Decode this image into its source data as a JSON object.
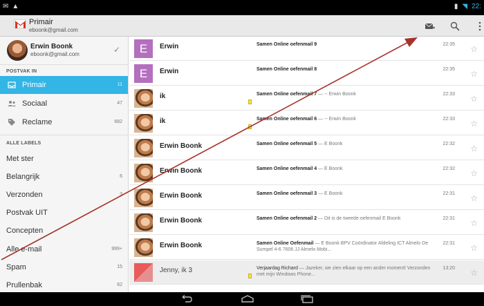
{
  "status_bar": {
    "left_icons": [
      "gmail-notification-icon",
      "person-icon"
    ],
    "time": "22:"
  },
  "action_bar": {
    "title": "Primair",
    "email": "eboonk@gmail.com",
    "icons": [
      "compose-icon",
      "search-icon",
      "overflow-menu-icon"
    ]
  },
  "sidebar": {
    "account": {
      "name": "Erwin Boonk",
      "email": "eboonk@gmail.com"
    },
    "inbox_header": "POSTVAK IN",
    "inbox_items": [
      {
        "label": "Primair",
        "count": "11",
        "icon": "inbox-icon",
        "active": true
      },
      {
        "label": "Sociaal",
        "count": "47",
        "icon": "people-icon"
      },
      {
        "label": "Reclame",
        "count": "682",
        "icon": "tag-icon"
      }
    ],
    "labels_header": "ALLE LABELS",
    "label_items": [
      {
        "label": "Met ster",
        "count": ""
      },
      {
        "label": "Belangrijk",
        "count": "6"
      },
      {
        "label": "Verzonden",
        "count": "3"
      },
      {
        "label": "Postvak UIT",
        "count": ""
      },
      {
        "label": "Concepten",
        "count": ""
      },
      {
        "label": "Alle e-mail",
        "count": "999+"
      },
      {
        "label": "Spam",
        "count": "15"
      },
      {
        "label": "Prullenbak",
        "count": "62"
      }
    ]
  },
  "emails": [
    {
      "sender": "Erwin",
      "avatar_letter": "E",
      "subject": "Samen Online oefenmail 9",
      "snippet": "",
      "time": "22:35",
      "tag": false
    },
    {
      "sender": "Erwin",
      "avatar_letter": "E",
      "subject": "Samen Online oefenmail 8",
      "snippet": "",
      "time": "22:35",
      "tag": false
    },
    {
      "sender": "ik",
      "avatar_letter": "",
      "subject": "Samen Online oefenmail 7",
      "snippet": " — -- Erwin Boonk",
      "time": "22:33",
      "tag": true
    },
    {
      "sender": "ik",
      "avatar_letter": "",
      "subject": "Samen Online oefenmail 6",
      "snippet": " — -- Erwin Boonk",
      "time": "22:33",
      "tag": true
    },
    {
      "sender": "Erwin Boonk",
      "avatar_letter": "",
      "subject": "Samen Online oefenmail 5",
      "snippet": " — E Boonk",
      "time": "22:32",
      "tag": false
    },
    {
      "sender": "Erwin Boonk",
      "avatar_letter": "",
      "subject": "Samen Online oefenmail 4",
      "snippet": " — E Boonk",
      "time": "22:32",
      "tag": false
    },
    {
      "sender": "Erwin Boonk",
      "avatar_letter": "",
      "subject": "Samen Online oefenmail 3",
      "snippet": " — E Boonk",
      "time": "22:31",
      "tag": false
    },
    {
      "sender": "Erwin Boonk",
      "avatar_letter": "",
      "subject": "Samen Online oefenmail 2",
      "snippet": " — Dit is de tweede oefenmail E Boonk",
      "time": "22:31",
      "tag": false
    },
    {
      "sender": "Erwin Boonk",
      "avatar_letter": "",
      "subject": "Samen Online Oefenmail",
      "snippet": " — E Boonk BPV Coördinator Afdeling ICT Almelo De Sumpel 4-6 7606 JJ Almelo Mobi...",
      "time": "22:31",
      "tag": false
    },
    {
      "sender": "Jenny, ik 3",
      "avatar_letter": "",
      "subject": "Verjaardag Richard",
      "snippet": " — Jazeker, we zien elkaar op een ander moment! Verzonden met mijn Windows Phone...",
      "time": "13:20",
      "tag": true,
      "read": true
    }
  ],
  "colors": {
    "accent": "#33b5e5",
    "letter_avatar": "#b46fbf",
    "annotation_arrow": "#a8322a"
  },
  "nav_bar_icons": [
    "back-icon",
    "home-icon",
    "recent-apps-icon"
  ]
}
